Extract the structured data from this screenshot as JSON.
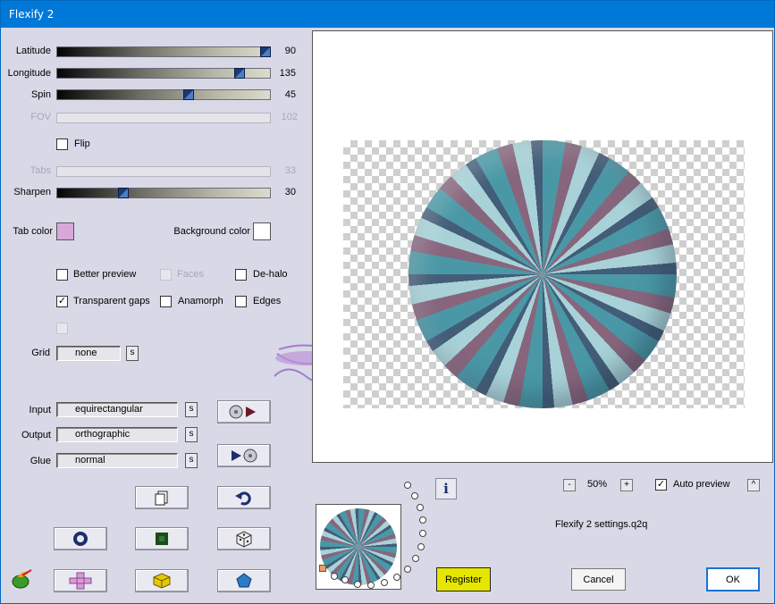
{
  "window": {
    "title": "Flexify 2"
  },
  "sliders": [
    {
      "label": "Latitude",
      "value": "90",
      "enabled": true
    },
    {
      "label": "Longitude",
      "value": "135",
      "enabled": true
    },
    {
      "label": "Spin",
      "value": "45",
      "enabled": true
    },
    {
      "label": "FOV",
      "value": "102",
      "enabled": false
    },
    {
      "label": "Tabs",
      "value": "33",
      "enabled": false
    },
    {
      "label": "Sharpen",
      "value": "30",
      "enabled": true
    }
  ],
  "flip": {
    "label": "Flip",
    "checked": false
  },
  "colors": {
    "tab_label": "Tab color",
    "tab_color": "#d8a8d8",
    "background_label": "Background color",
    "background_color": "#ffffff",
    "accent": "#0078d7",
    "register_bg": "#e6e600"
  },
  "options": {
    "better_preview": {
      "label": "Better preview",
      "checked": false
    },
    "faces": {
      "label": "Faces",
      "checked": false,
      "enabled": false
    },
    "de_halo": {
      "label": "De-halo",
      "checked": false
    },
    "transparent_gaps": {
      "label": "Transparent gaps",
      "checked": true
    },
    "anamorph": {
      "label": "Anamorph",
      "checked": false
    },
    "edges": {
      "label": "Edges",
      "checked": false
    }
  },
  "grid": {
    "label": "Grid",
    "value": "none",
    "s_label": "s"
  },
  "projection": {
    "input_label": "Input",
    "input_value": "equirectangular",
    "output_label": "Output",
    "output_value": "orthographic",
    "glue_label": "Glue",
    "glue_value": "normal",
    "s_label": "s"
  },
  "zoom": {
    "minus": "-",
    "value": "50%",
    "plus": "+"
  },
  "auto_preview": {
    "label": "Auto preview",
    "checked": true,
    "expand": "^"
  },
  "info_label": "i",
  "settings_file": "Flexify 2 settings.q2q",
  "buttons": {
    "register": "Register",
    "cancel": "Cancel",
    "ok": "OK"
  },
  "icons": [
    "render-play-icon",
    "play-render-icon",
    "copy-icon",
    "undo-icon",
    "ring-icon",
    "frame-icon",
    "dice-icon",
    "plugin-logo-icon",
    "cross-icon",
    "cube-icon",
    "pentagon-icon"
  ]
}
